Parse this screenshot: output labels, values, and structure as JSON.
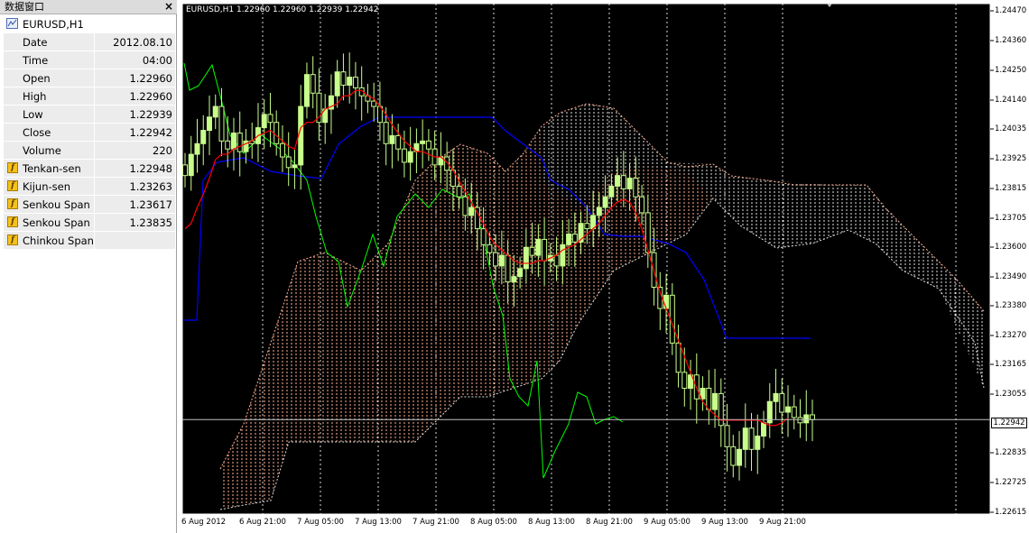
{
  "data_window": {
    "title": "数据窗口",
    "close_label": "×",
    "symbol": "EURUSD,H1",
    "rows": [
      {
        "label": "Date",
        "value": "2012.08.10",
        "icon": ""
      },
      {
        "label": "Time",
        "value": "04:00",
        "icon": ""
      },
      {
        "label": "Open",
        "value": "1.22960",
        "icon": ""
      },
      {
        "label": "High",
        "value": "1.22960",
        "icon": ""
      },
      {
        "label": "Low",
        "value": "1.22939",
        "icon": ""
      },
      {
        "label": "Close",
        "value": "1.22942",
        "icon": ""
      },
      {
        "label": "Volume",
        "value": "220",
        "icon": ""
      },
      {
        "label": "Tenkan-sen",
        "value": "1.22948",
        "icon": "indicator-f-icon"
      },
      {
        "label": "Kijun-sen",
        "value": "1.23263",
        "icon": "indicator-f-icon"
      },
      {
        "label": "Senkou Span",
        "value": "1.23617",
        "icon": "indicator-f-icon"
      },
      {
        "label": "Senkou Span",
        "value": "1.23835",
        "icon": "indicator-f-icon"
      },
      {
        "label": "Chinkou Span",
        "value": "",
        "icon": "indicator-f-icon"
      }
    ]
  },
  "chart": {
    "header": "EURUSD,H1  1.22960 1.22960 1.22939 1.22942",
    "current_price": "1.22942",
    "price_labels": [
      "1.24470",
      "1.24360",
      "1.24250",
      "1.24140",
      "1.24035",
      "1.23925",
      "1.23815",
      "1.23705",
      "1.23600",
      "1.23490",
      "1.23380",
      "1.23270",
      "1.23165",
      "1.23055",
      "1.22835",
      "1.22725",
      "1.22615"
    ],
    "time_labels": [
      "6 Aug 2012",
      "6 Aug 21:00",
      "7 Aug 05:00",
      "7 Aug 13:00",
      "7 Aug 21:00",
      "8 Aug 05:00",
      "8 Aug 13:00",
      "8 Aug 21:00",
      "9 Aug 05:00",
      "9 Aug 13:00",
      "9 Aug 21:00"
    ],
    "colors": {
      "background": "#000000",
      "candles": "#c8ff8c",
      "tenkan": "#ff0000",
      "kijun": "#0000ff",
      "chinkou": "#00ff00",
      "cloud_bull": "#ffb090",
      "cloud_bear": "#e0e0e0",
      "grid": "#ffffff"
    }
  },
  "chart_data": {
    "type": "candlestick",
    "symbol": "EURUSD",
    "timeframe": "H1",
    "last_bar": {
      "open": 1.2296,
      "high": 1.2296,
      "low": 1.22939,
      "close": 1.22942
    },
    "ylim": [
      1.2258,
      1.245
    ],
    "y_ticks": [
      1.2447,
      1.2436,
      1.2425,
      1.2414,
      1.24035,
      1.23925,
      1.23815,
      1.23705,
      1.236,
      1.2349,
      1.2338,
      1.2327,
      1.23165,
      1.23055,
      1.22835,
      1.22725,
      1.22615
    ],
    "x_ticks": [
      "6 Aug 2012",
      "6 Aug 21:00",
      "7 Aug 05:00",
      "7 Aug 13:00",
      "7 Aug 21:00",
      "8 Aug 05:00",
      "8 Aug 13:00",
      "8 Aug 21:00",
      "9 Aug 05:00",
      "9 Aug 13:00",
      "9 Aug 21:00"
    ],
    "closes": [
      1.2386,
      1.2394,
      1.2398,
      1.2403,
      1.2408,
      1.2412,
      1.2399,
      1.2396,
      1.2402,
      1.2395,
      1.2399,
      1.2398,
      1.2404,
      1.2409,
      1.2406,
      1.2398,
      1.2393,
      1.2389,
      1.239,
      1.2412,
      1.2424,
      1.2417,
      1.2406,
      1.2411,
      1.2416,
      1.2425,
      1.242,
      1.2423,
      1.2419,
      1.2416,
      1.2414,
      1.2412,
      1.2406,
      1.2398,
      1.2401,
      1.2396,
      1.2391,
      1.2395,
      1.2398,
      1.2399,
      1.2396,
      1.239,
      1.2393,
      1.2388,
      1.2382,
      1.2378,
      1.2371,
      1.2374,
      1.2366,
      1.236,
      1.2357,
      1.2352,
      1.2356,
      1.2346,
      1.2348,
      1.2351,
      1.2359,
      1.2356,
      1.2362,
      1.2354,
      1.2356,
      1.2352,
      1.236,
      1.2364,
      1.2361,
      1.2368,
      1.2366,
      1.2371,
      1.2374,
      1.2378,
      1.2382,
      1.2386,
      1.2381,
      1.2385,
      1.2378,
      1.2372,
      1.2357,
      1.2344,
      1.2336,
      1.2341,
      1.2323,
      1.2312,
      1.2306,
      1.2311,
      1.2302,
      1.2306,
      1.2298,
      1.2304,
      1.2292,
      1.2284,
      1.2277,
      1.2283,
      1.2291,
      1.2283,
      1.2288,
      1.2293,
      1.2301,
      1.2304,
      1.2297,
      1.2299,
      1.2295,
      1.2293,
      1.2296,
      1.22942
    ],
    "tenkan": [
      1.2366,
      1.2368,
      1.2374,
      1.2379,
      1.2385,
      1.2392,
      1.2394,
      1.2394,
      1.2396,
      1.2397,
      1.2398,
      1.2399,
      1.2401,
      1.2402,
      1.2403,
      1.2401,
      1.2399,
      1.2397,
      1.2396,
      1.2404,
      1.2406,
      1.2406,
      1.2408,
      1.2411,
      1.2412,
      1.2413,
      1.2416,
      1.2416,
      1.2418,
      1.2418,
      1.2416,
      1.2415,
      1.2412,
      1.2409,
      1.2405,
      1.2402,
      1.2399,
      1.2397,
      1.2395,
      1.2395,
      1.2394,
      1.2393,
      1.2393,
      1.2391,
      1.2388,
      1.2384,
      1.238,
      1.2376,
      1.2372,
      1.2368,
      1.2363,
      1.236,
      1.2358,
      1.2356,
      1.2354,
      1.2353,
      1.2353,
      1.2353,
      1.2354,
      1.2354,
      1.2355,
      1.2356,
      1.2358,
      1.2359,
      1.236,
      1.2362,
      1.2364,
      1.2366,
      1.2368,
      1.2371,
      1.2374,
      1.2376,
      1.2377,
      1.2376,
      1.2372,
      1.2366,
      1.2358,
      1.235,
      1.2342,
      1.2336,
      1.233,
      1.2324,
      1.2318,
      1.2312,
      1.2306,
      1.2301,
      1.2298,
      1.2296,
      1.2294,
      1.2294,
      1.2294,
      1.2294,
      1.2294,
      1.2294,
      1.2294,
      1.2293,
      1.2292,
      1.2292,
      1.2293,
      1.22948
    ]
  }
}
